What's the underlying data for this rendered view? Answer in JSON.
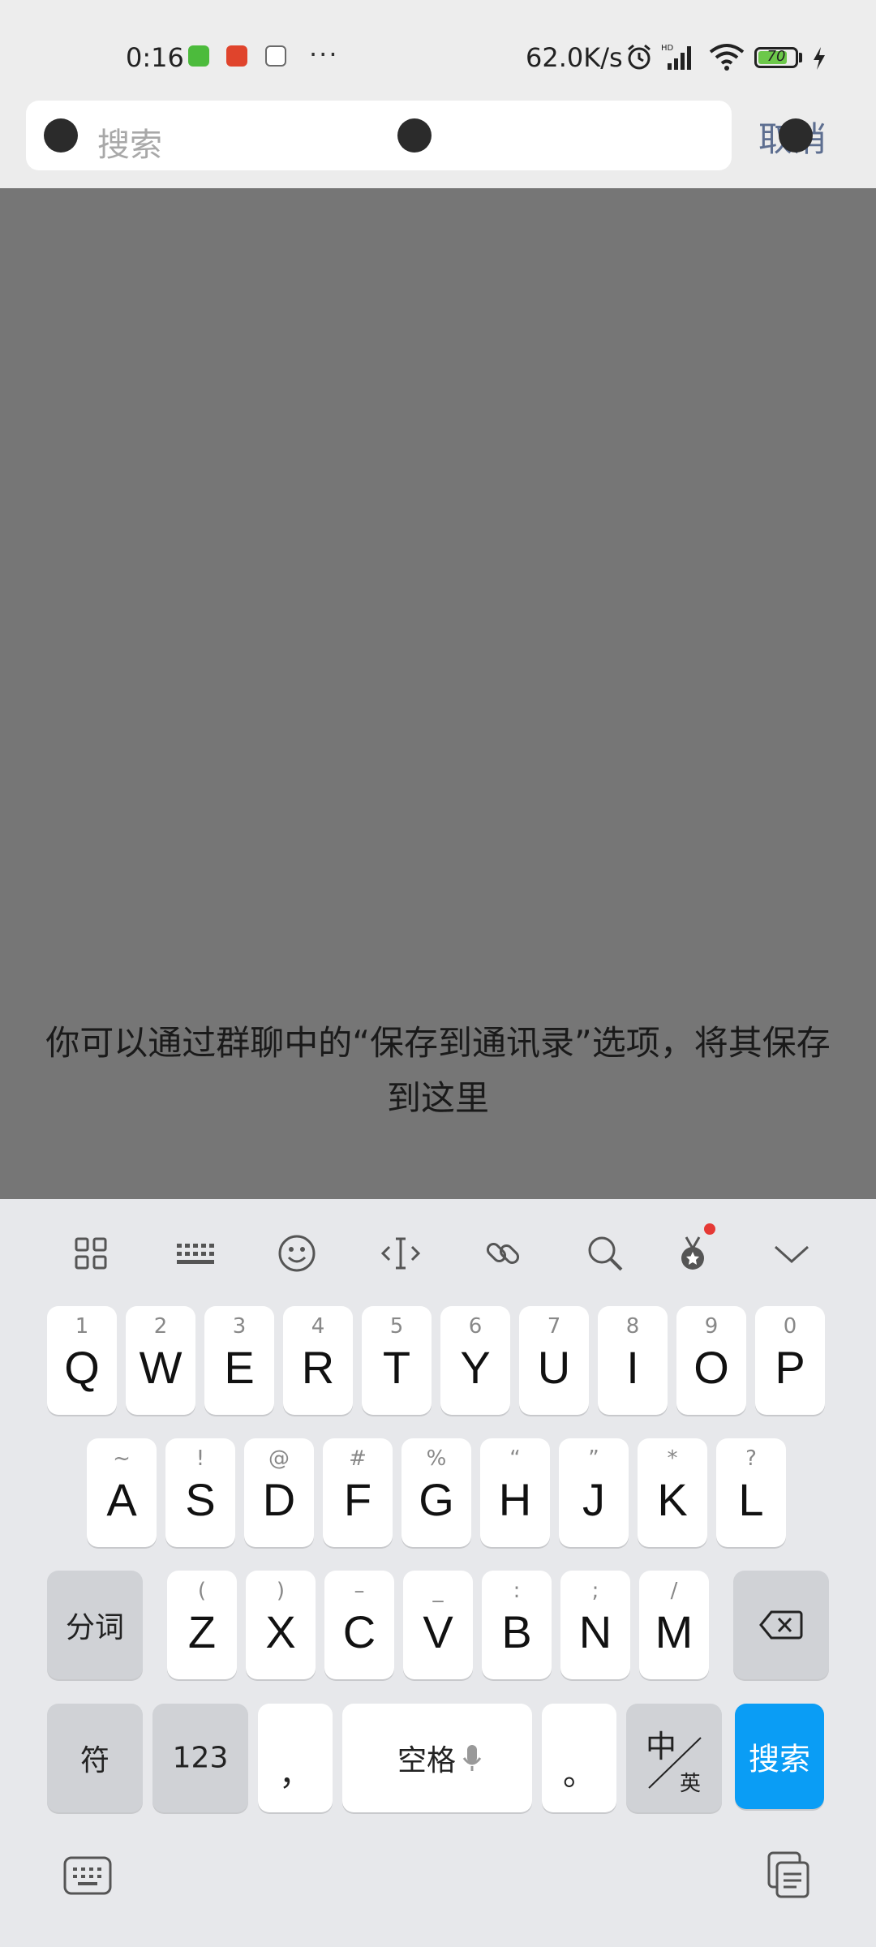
{
  "status_bar": {
    "time": "0:16",
    "dots": "···",
    "net_speed": "62.0K/s",
    "battery_level": "70",
    "app_icon_colors": [
      "#4cbb3c",
      "#e0442c",
      "#6a6a6a"
    ]
  },
  "search": {
    "placeholder": "搜索",
    "cancel_label": "取消"
  },
  "hint": "你可以通过群聊中的“保存到通讯录”选项，将其保存到这里",
  "toolbar": {
    "icons": [
      "grid-icon",
      "keyboard-layout-icon",
      "emoji-icon",
      "cursor-icon",
      "link-icon",
      "search-icon",
      "medal-icon",
      "collapse-icon"
    ]
  },
  "keyboard": {
    "row1": [
      {
        "main": "Q",
        "sub": "1"
      },
      {
        "main": "W",
        "sub": "2"
      },
      {
        "main": "E",
        "sub": "3"
      },
      {
        "main": "R",
        "sub": "4"
      },
      {
        "main": "T",
        "sub": "5"
      },
      {
        "main": "Y",
        "sub": "6"
      },
      {
        "main": "U",
        "sub": "7"
      },
      {
        "main": "I",
        "sub": "8"
      },
      {
        "main": "O",
        "sub": "9"
      },
      {
        "main": "P",
        "sub": "0"
      }
    ],
    "row2": [
      {
        "main": "A",
        "sub": "~"
      },
      {
        "main": "S",
        "sub": "!"
      },
      {
        "main": "D",
        "sub": "@"
      },
      {
        "main": "F",
        "sub": "#"
      },
      {
        "main": "G",
        "sub": "%"
      },
      {
        "main": "H",
        "sub": "“"
      },
      {
        "main": "J",
        "sub": "”"
      },
      {
        "main": "K",
        "sub": "*"
      },
      {
        "main": "L",
        "sub": "?"
      }
    ],
    "row3": [
      {
        "main": "Z",
        "sub": "("
      },
      {
        "main": "X",
        "sub": ")"
      },
      {
        "main": "C",
        "sub": "–"
      },
      {
        "main": "V",
        "sub": "_"
      },
      {
        "main": "B",
        "sub": ":"
      },
      {
        "main": "N",
        "sub": ";"
      },
      {
        "main": "M",
        "sub": "/"
      }
    ],
    "segment_label": "分词",
    "symbol_label": "符",
    "number_label": "123",
    "comma_label": "，",
    "space_label": "空格",
    "period_label": "。",
    "lang_label_top": "中",
    "lang_label_bottom": "英",
    "search_label": "搜索"
  },
  "colors": {
    "accent": "#0a9df5",
    "cancel": "#5d6e90",
    "overlay": "#767676"
  }
}
